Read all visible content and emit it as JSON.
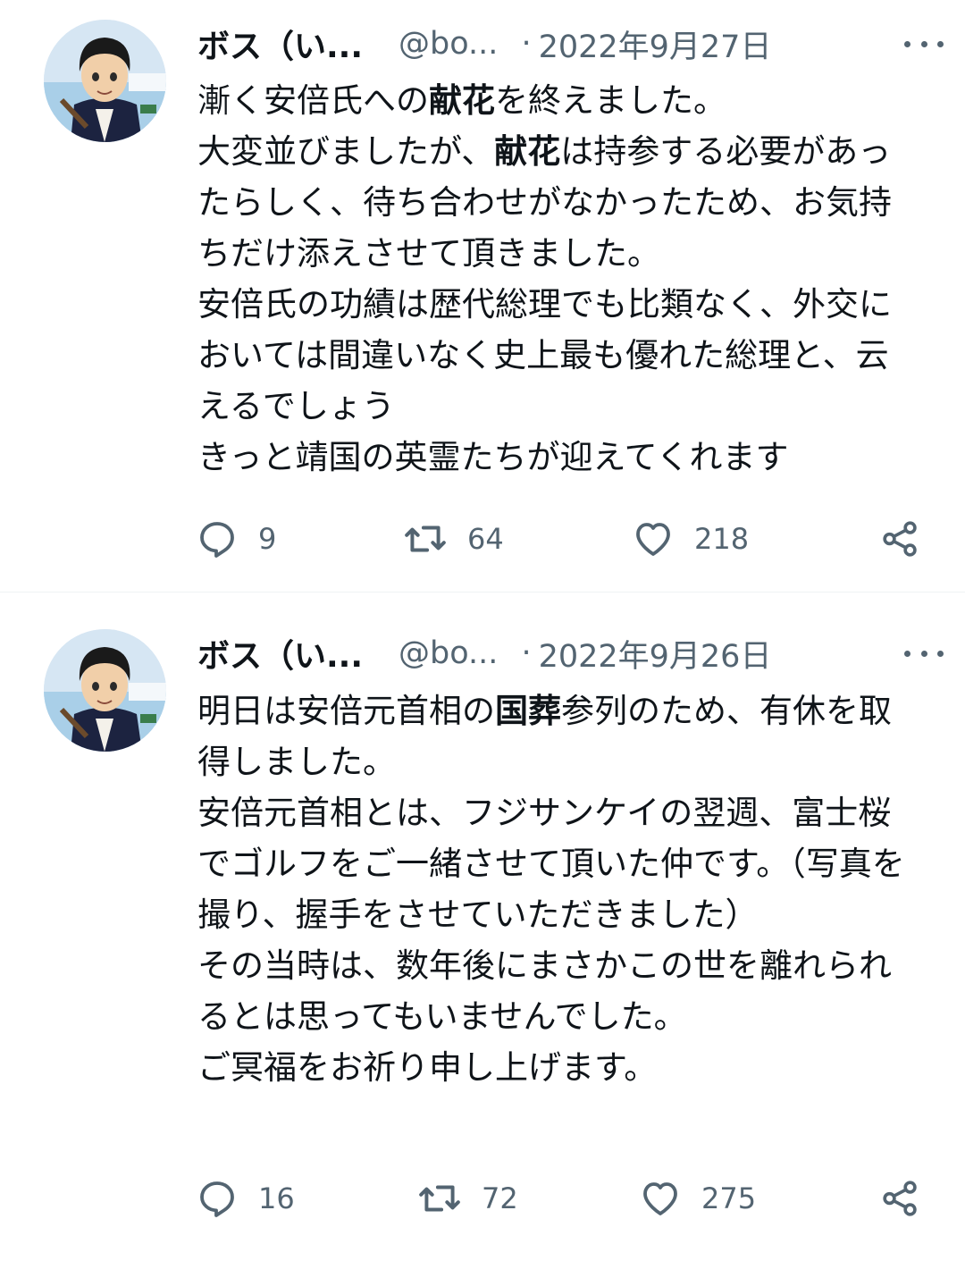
{
  "tweets": [
    {
      "author_name": "ボス（い...",
      "author_handle": "@bo...",
      "separator": "·",
      "date": "2022年9月27日",
      "text_parts": [
        {
          "text": "漸く安倍氏への",
          "bold": false
        },
        {
          "text": "献花",
          "bold": true
        },
        {
          "text": "を終えました。\n大変並びましたが、",
          "bold": false
        },
        {
          "text": "献花",
          "bold": true
        },
        {
          "text": "は持参する必要があったらしく、待ち合わせがなかったため、お気持ちだけ添えさせて頂きました。\n安倍氏の功績は歴代総理でも比類なく、外交においては間違いなく史上最も優れた総理と、云えるでしょう\nきっと靖国の英霊たちが迎えてくれます",
          "bold": false
        }
      ],
      "replies": "9",
      "retweets": "64",
      "likes": "218"
    },
    {
      "author_name": "ボス（い...",
      "author_handle": "@bo...",
      "separator": "·",
      "date": "2022年9月26日",
      "text_parts": [
        {
          "text": "明日は安倍元首相の",
          "bold": false
        },
        {
          "text": "国葬",
          "bold": true
        },
        {
          "text": "参列のため、有休を取得しました。\n安倍元首相とは、フジサンケイの翌週、富士桜でゴルフをご一緒させて頂いた仲です。（写真を撮り、握手をさせていただきました）\nその当時は、数年後にまさかこの世を離れられるとは思ってもいませんでした。\nご冥福をお祈り申し上げます。",
          "bold": false
        }
      ],
      "replies": "16",
      "retweets": "72",
      "likes": "275"
    }
  ],
  "colors": {
    "text_primary": "#0f1419",
    "text_secondary": "#536471",
    "divider": "#eff3f4"
  },
  "icons": {
    "reply": "reply-icon",
    "retweet": "retweet-icon",
    "like": "heart-icon",
    "share": "share-icon",
    "more": "more-icon"
  }
}
